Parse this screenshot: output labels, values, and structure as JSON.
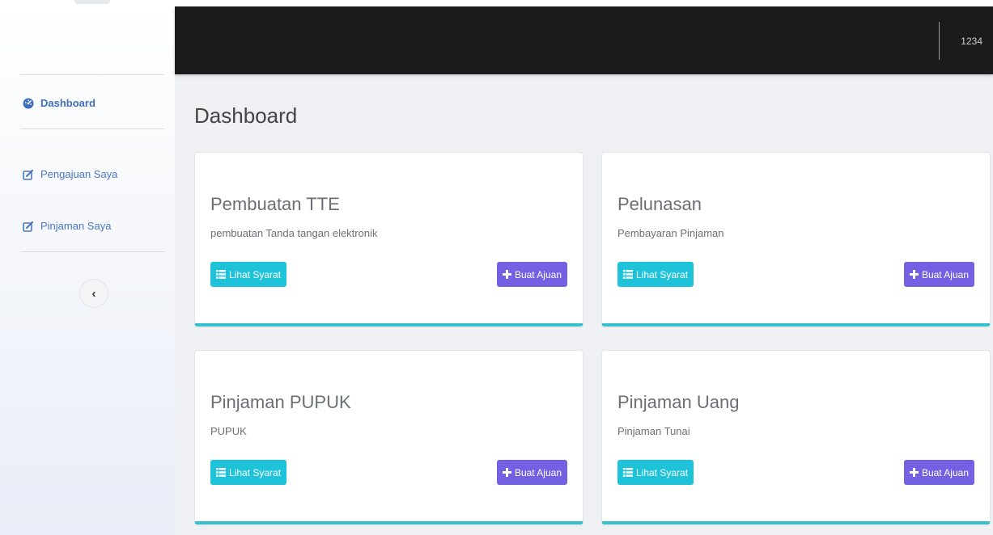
{
  "header": {
    "user": "1234"
  },
  "sidebar": {
    "items": [
      {
        "label": "Dashboard",
        "icon": "dashboard-icon",
        "active": true
      },
      {
        "label": "Pengajuan Saya",
        "icon": "edit-icon",
        "active": false
      },
      {
        "label": "Pinjaman Saya",
        "icon": "edit-icon",
        "active": false
      }
    ],
    "collapse_icon": "chevron-left-icon"
  },
  "main": {
    "title": "Dashboard",
    "cards": [
      {
        "title": "Pembuatan TTE",
        "subtitle": "pembuatan Tanda tangan elektronik",
        "btn_syarat": "Lihat Syarat",
        "btn_ajuan": "Buat Ajuan"
      },
      {
        "title": "Pelunasan",
        "subtitle": "Pembayaran Pinjaman",
        "btn_syarat": "Lihat Syarat",
        "btn_ajuan": "Buat Ajuan"
      },
      {
        "title": "Pinjaman PUPUK",
        "subtitle": "PUPUK",
        "btn_syarat": "Lihat Syarat",
        "btn_ajuan": "Buat Ajuan"
      },
      {
        "title": "Pinjaman Uang",
        "subtitle": "Pinjaman Tunai",
        "btn_syarat": "Lihat Syarat",
        "btn_ajuan": "Buat Ajuan"
      }
    ]
  },
  "colors": {
    "header_bg": "#1b1b1b",
    "info_button": "#1ec2d9",
    "primary_button": "#7360e2",
    "card_accent": "#36bfcd",
    "sidebar_link": "#4a78c2"
  }
}
